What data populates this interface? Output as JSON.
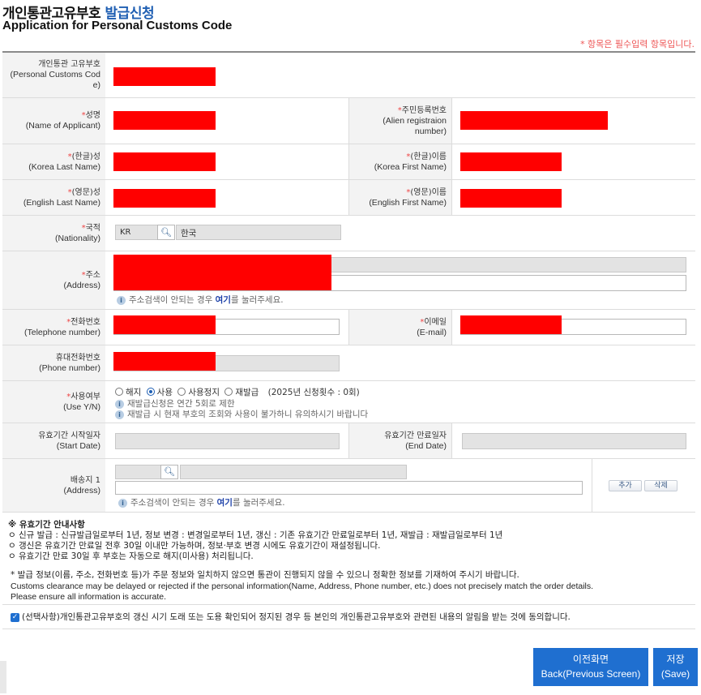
{
  "header": {
    "title_ko_main": "개인통관고유부호",
    "title_ko_accent": "발급신청",
    "title_en": "Application for Personal Customs Code",
    "required_note": "* 항목은 필수입력 항목입니다."
  },
  "fields": {
    "pcc": {
      "ko": "개인통관 고유부호",
      "en": "(Personal Customs Code)"
    },
    "name": {
      "star": "*",
      "ko": "성명",
      "en": "(Name of Applicant)"
    },
    "alien_no": {
      "star": "*",
      "ko": "주민등록번호",
      "en": "(Alien registraion number)"
    },
    "kor_last": {
      "star": "*",
      "ko": "(한글)성",
      "en": "(Korea Last Name)"
    },
    "kor_first": {
      "star": "*",
      "ko": "(한글)이름",
      "en": "(Korea First Name)"
    },
    "eng_last": {
      "star": "*",
      "ko": "(영문)성",
      "en": "(English Last Name)"
    },
    "eng_first": {
      "star": "*",
      "ko": "(영문)이름",
      "en": "(English First Name)"
    },
    "nationality": {
      "star": "*",
      "ko": "국적",
      "en": "(Nationality)",
      "code": "KR",
      "name": "한국"
    },
    "address": {
      "star": "*",
      "ko": "주소",
      "en": "(Address)",
      "hint_pre": "주소검색이 안되는 경우 ",
      "hint_link": "여기",
      "hint_post": "를 눌러주세요."
    },
    "telephone": {
      "star": "*",
      "ko": "전화번호",
      "en": "(Telephone number)"
    },
    "email": {
      "star": "*",
      "ko": "이메일",
      "en": "(E-mail)"
    },
    "mobile": {
      "ko": "휴대전화번호",
      "en": "(Phone number)"
    },
    "use_yn": {
      "star": "*",
      "ko": "사용여부",
      "en": "(Use Y/N)",
      "options": [
        "해지",
        "사용",
        "사용정지",
        "재발급"
      ],
      "selected": "사용",
      "reissue_count": "(2025년 신청횟수 : 0회)",
      "hint1": "재발급신청은 연간 5회로 제한",
      "hint2": "재발급 시 현재 부호의 조회와 사용이 불가하니 유의하시기 바랍니다"
    },
    "start_date": {
      "ko": "유효기간 시작일자",
      "en": "(Start Date)"
    },
    "end_date": {
      "ko": "유효기간 만료일자",
      "en": "(End Date)"
    },
    "delivery": {
      "ko": "배송지 1",
      "en": "(Address)",
      "hint_pre": "주소검색이 안되는 경우 ",
      "hint_link": "여기",
      "hint_post": "를 눌러주세요.",
      "add_label": "추가",
      "delete_label": "삭제"
    }
  },
  "notice": {
    "heading": "※ 유효기간 안내사항",
    "line1": "ㅇ 신규 발급 : 신규발급일로부터 1년, 정보 변경 : 변경일로부터 1년, 갱신 : 기존 유효기간 만료일로부터 1년, 재발급 : 재발급일로부터 1년",
    "line2": "ㅇ 갱신은 유효기간 만료일 전후 30일 이내만 가능하며, 정보·부호 변경 시에도 유효기간이 재설정됩니다.",
    "line3": "ㅇ 유효기간 만료 30일 후 부호는 자동으로 해지(미사용) 처리됩니다.",
    "warn_ko": "* 발급 정보(이름, 주소, 전화번호 등)가 주문 정보와 일치하지 않으면 통관이 진행되지 않을 수 있으니 정확한 정보를 기재하여 주시기 바랍니다.",
    "warn_en1": "Customs clearance may be delayed or rejected if the personal information(Name, Address, Phone number, etc.) does not precisely match the order details.",
    "warn_en2": "Please ensure all information is accurate.",
    "consent": "(선택사항)개인통관고유부호의 갱신 시기 도래 또는 도용 확인되어 정지된 경우 등 본인의 개인통관고유부호와 관련된 내용의 알림을 받는 것에 동의합니다."
  },
  "buttons": {
    "back_ko": "이전화면",
    "back_en": "Back(Previous Screen)",
    "save_ko": "저장",
    "save_en": "(Save)"
  },
  "colors": {
    "accent": "#1f5fb3",
    "button": "#1f6fd0",
    "required": "#ee4444",
    "redaction": "#ff0000"
  }
}
